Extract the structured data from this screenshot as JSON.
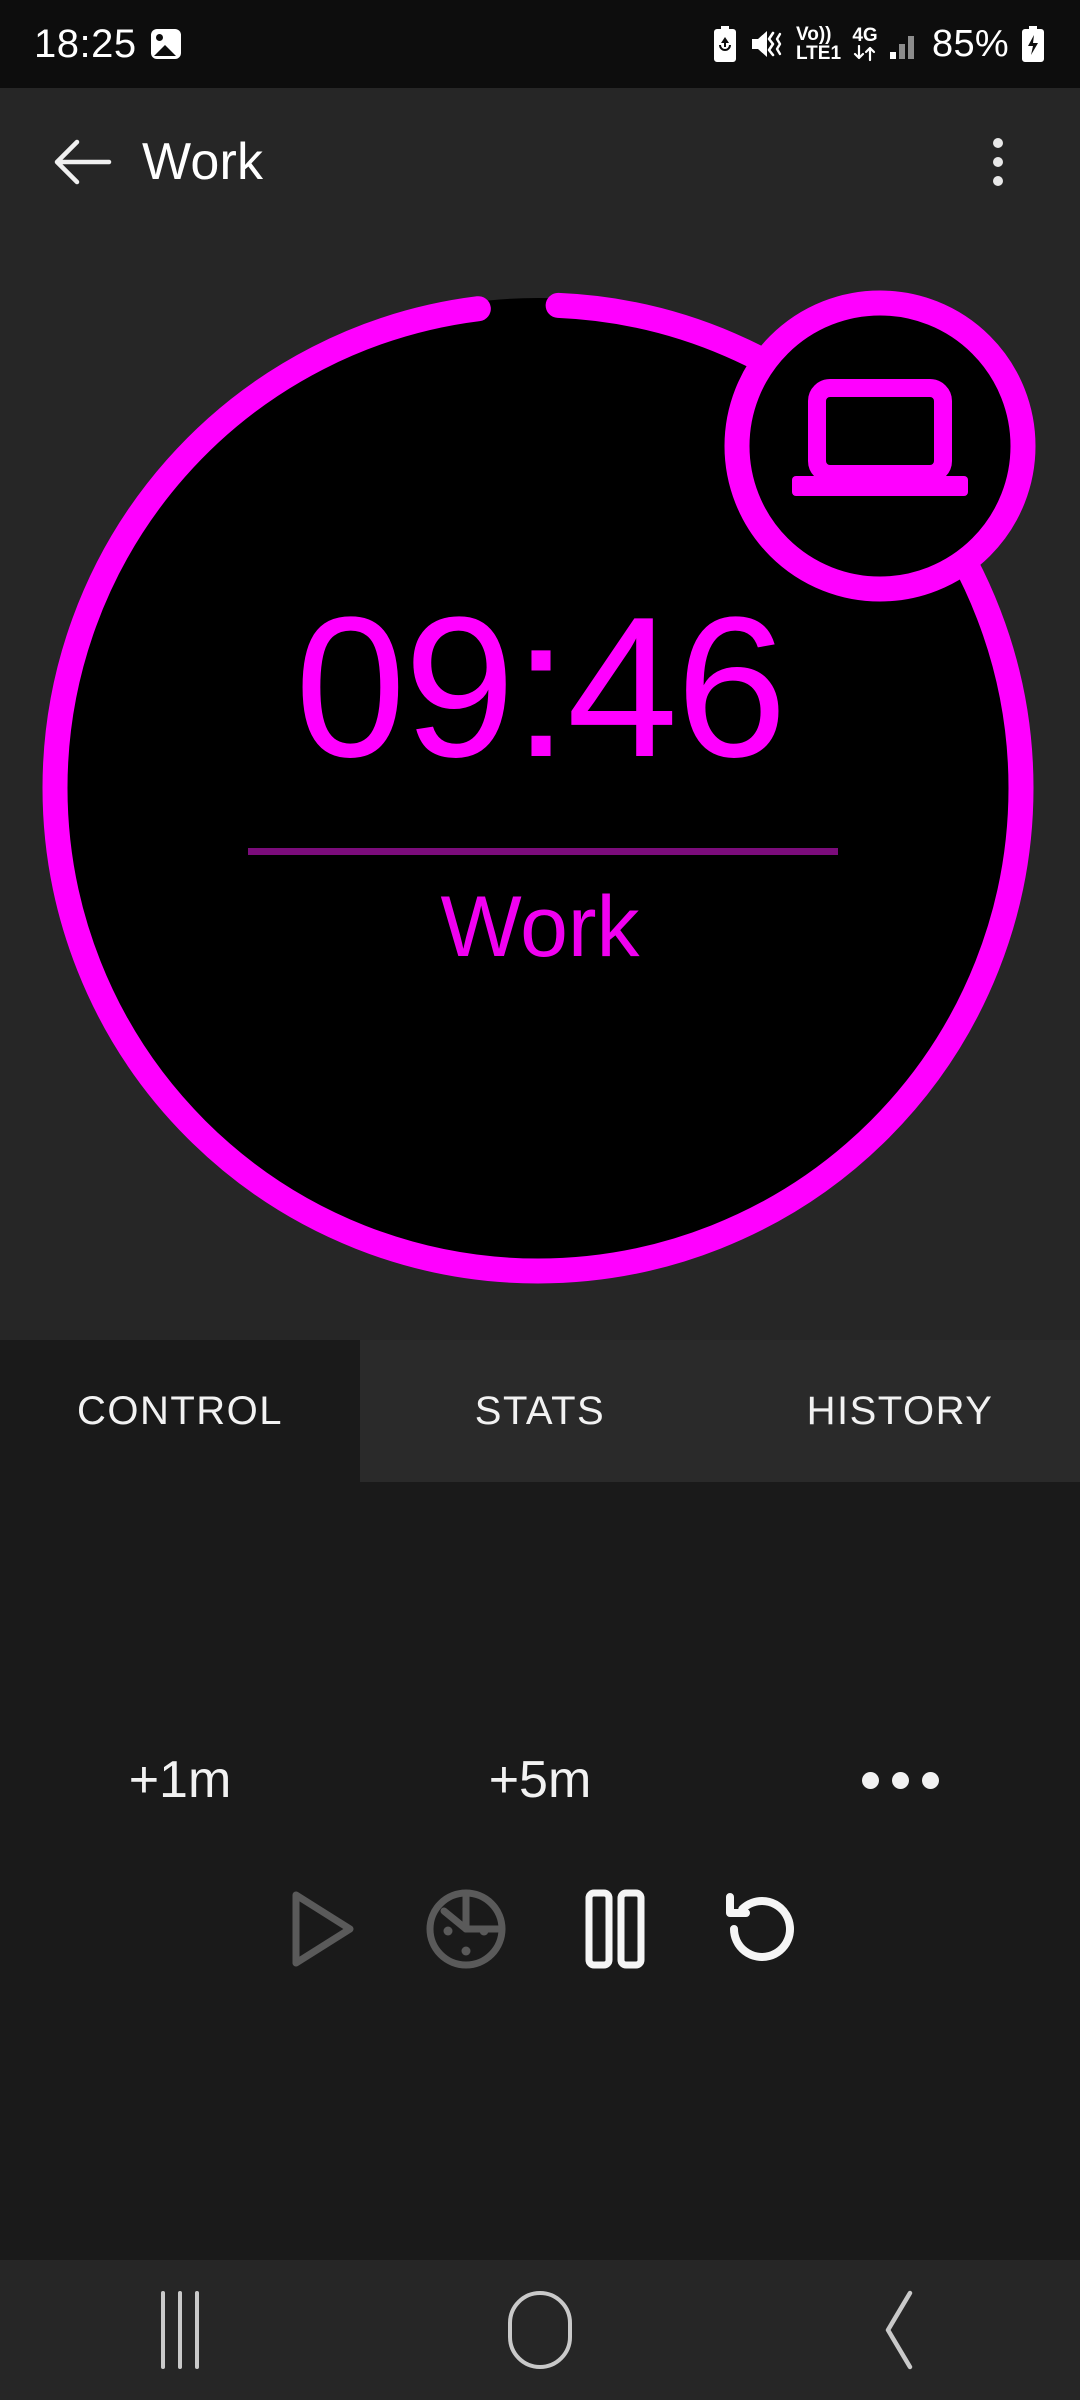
{
  "status_bar": {
    "clock": "18:25",
    "icons_left": [
      "gallery-image-icon"
    ],
    "icons_right": [
      "battery-saver-icon",
      "vibrate-mute-icon",
      "volte-icon",
      "network-4g-icon",
      "signal-bars-icon",
      "battery-charging-icon"
    ],
    "volte_top": "Vo))",
    "volte_bottom": "LTE1",
    "network_type": "4G",
    "battery_percent": "85%"
  },
  "app_bar": {
    "back_label": "back-arrow",
    "title": "Work",
    "overflow_label": "more-options"
  },
  "timer": {
    "value": "09:46",
    "label": "Work",
    "badge_icon": "laptop-icon",
    "progress_percent": 98,
    "ring_color": "#FF00FF",
    "ring_track_color": "#000000",
    "divider_color": "#7B0C7B",
    "inner_color": "#000000"
  },
  "tabs": [
    {
      "label": "CONTROL",
      "selected": true
    },
    {
      "label": "STATS",
      "selected": false
    },
    {
      "label": "HISTORY",
      "selected": false
    }
  ],
  "controls": {
    "quick": [
      {
        "label": "+1m",
        "name": "add-one-minute-button"
      },
      {
        "label": "+5m",
        "name": "add-five-minutes-button"
      },
      {
        "label": "•••",
        "name": "more-adjust-button"
      }
    ],
    "buttons": [
      {
        "name": "play-button",
        "icon": "play-icon",
        "enabled": false
      },
      {
        "name": "skip-timer-button",
        "icon": "timer-dial-icon",
        "enabled": false
      },
      {
        "name": "pause-button",
        "icon": "pause-icon",
        "enabled": true
      },
      {
        "name": "reset-button",
        "icon": "restart-icon",
        "enabled": true
      }
    ]
  },
  "nav_bar": {
    "recents": "recents-icon",
    "home": "home-icon",
    "back": "back-icon"
  },
  "colors": {
    "accent": "#FF00FF",
    "background": "#262626",
    "content_background": "#1A1A1A",
    "status_background": "#0D0D0D",
    "disabled": "#5A5A5A",
    "enabled": "#F5F5F5"
  }
}
